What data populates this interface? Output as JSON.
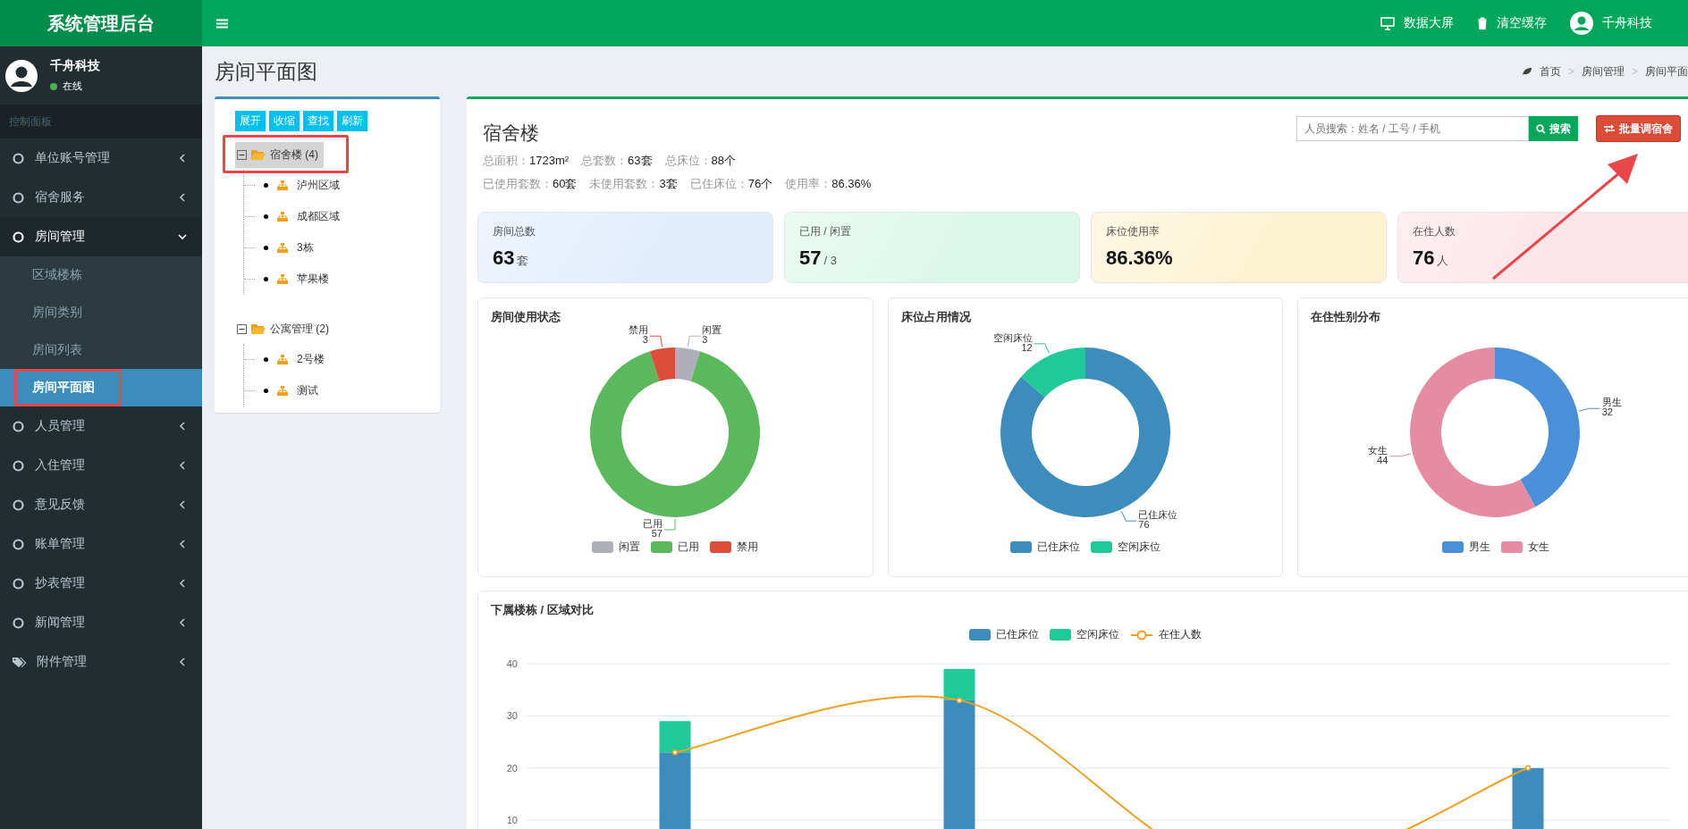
{
  "header": {
    "brand": "系统管理后台",
    "actions": [
      {
        "label": "数据大屏",
        "kind": "monitor"
      },
      {
        "label": "清空缓存",
        "kind": "trash"
      },
      {
        "label": "千舟科技",
        "kind": "user"
      }
    ]
  },
  "sidebar": {
    "user": {
      "name": "千舟科技",
      "status": "在线",
      "online": true
    },
    "section": "控制面板",
    "items": [
      {
        "label": "单位账号管理",
        "kind": "circle",
        "expanded": false
      },
      {
        "label": "宿舍服务",
        "kind": "circle",
        "expanded": false
      },
      {
        "label": "房间管理",
        "kind": "circle",
        "expanded": true,
        "children": [
          {
            "label": "区域楼栋",
            "selected": false,
            "annotated": false
          },
          {
            "label": "房间类别",
            "selected": false,
            "annotated": false
          },
          {
            "label": "房间列表",
            "selected": false,
            "annotated": false
          },
          {
            "label": "房间平面图",
            "selected": true,
            "annotated": true
          }
        ]
      },
      {
        "label": "人员管理",
        "kind": "circle",
        "expanded": false
      },
      {
        "label": "入住管理",
        "kind": "circle",
        "expanded": false
      },
      {
        "label": "意见反馈",
        "kind": "circle",
        "expanded": false
      },
      {
        "label": "账单管理",
        "kind": "circle",
        "expanded": false
      },
      {
        "label": "抄表管理",
        "kind": "circle",
        "expanded": false
      },
      {
        "label": "新闻管理",
        "kind": "circle",
        "expanded": false
      },
      {
        "label": "附件管理",
        "kind": "tag",
        "expanded": false
      }
    ]
  },
  "page": {
    "title": "房间平面图",
    "breadcrumb": {
      "separator": ">",
      "items": [
        "首页",
        "房间管理",
        "房间平面"
      ]
    }
  },
  "tree": {
    "buttons": [
      "展开",
      "收缩",
      "查找",
      "刷新"
    ],
    "nodes": [
      {
        "label": "宿舍楼 (4)",
        "expanded": true,
        "selected": true,
        "annotated": true,
        "children": [
          {
            "label": "泸州区域"
          },
          {
            "label": "成都区域"
          },
          {
            "label": "3栋"
          },
          {
            "label": "苹果楼"
          }
        ]
      },
      {
        "label": "公寓管理 (2)",
        "expanded": true,
        "selected": false,
        "annotated": false,
        "children": [
          {
            "label": "2号楼"
          },
          {
            "label": "测试"
          }
        ]
      }
    ]
  },
  "building": {
    "title": "宿舍楼",
    "stats": [
      [
        {
          "label": "总面积：",
          "value": "1723m²"
        },
        {
          "label": "总套数：",
          "value": "63套"
        },
        {
          "label": "总床位：",
          "value": "88个"
        }
      ],
      [
        {
          "label": "已使用套数：",
          "value": "60套"
        },
        {
          "label": "未使用套数：",
          "value": "3套"
        },
        {
          "label": "已住床位：",
          "value": "76个"
        },
        {
          "label": "使用率：",
          "value": "86.36%"
        }
      ]
    ],
    "search": {
      "placeholder": "人员搜索：姓名 / 工号 / 手机",
      "button": "搜索"
    },
    "batch_button": {
      "label": "批量调宿舍",
      "annotated": true
    },
    "cards": [
      {
        "label": "房间总数",
        "value": "63",
        "unit": "套",
        "color": "#e2edfc"
      },
      {
        "label": "已用 / 闲置",
        "value": "57",
        "unit": "/ 3",
        "color": "#dcf8ea"
      },
      {
        "label": "床位使用率",
        "value": "86.36%",
        "color": "#fdf3d2"
      },
      {
        "label": "在住人数",
        "value": "76",
        "unit": "人",
        "color": "#fde4e8"
      }
    ],
    "donuts": [
      {
        "title": "房间使用状态",
        "chart_data": {
          "type": "donut",
          "categories": [
            "闲置",
            "已用",
            "禁用"
          ],
          "values": [
            3,
            57,
            3
          ],
          "colors": [
            "#aeb0b9",
            "#5cb85c",
            "#dd4b39"
          ],
          "data_labels": true
        }
      },
      {
        "title": "床位占用情况",
        "chart_data": {
          "type": "donut",
          "categories": [
            "已住床位",
            "空闲床位"
          ],
          "values": [
            76,
            12
          ],
          "colors": [
            "#3c8dbc",
            "#20c997"
          ],
          "data_labels": true
        }
      },
      {
        "title": "在住性别分布",
        "chart_data": {
          "type": "donut",
          "categories": [
            "男生",
            "女生"
          ],
          "values": [
            32,
            44
          ],
          "colors": [
            "#4a90d9",
            "#e78aa4"
          ],
          "data_labels": true
        }
      }
    ],
    "compare": {
      "title": "下属楼栋 / 区域对比",
      "chart_data": {
        "type": "bar",
        "stacked": true,
        "grid": true,
        "ylim": [
          0,
          40
        ],
        "yticks": [
          10,
          20,
          30,
          40
        ],
        "series": [
          {
            "name": "已住床位",
            "color": "#3c8dbc",
            "values": [
              23,
              33,
              0,
              20
            ]
          },
          {
            "name": "空闲床位",
            "color": "#20c997",
            "values": [
              6,
              6,
              0,
              0
            ]
          },
          {
            "name": "在住人数",
            "color": "#f0a020",
            "values": [
              23,
              33,
              0,
              20
            ],
            "type": "line"
          }
        ]
      }
    }
  }
}
